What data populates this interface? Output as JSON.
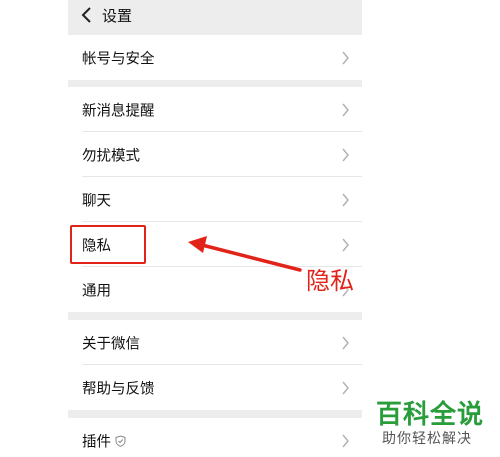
{
  "header": {
    "title": "设置"
  },
  "groups": [
    {
      "items": [
        {
          "label": "帐号与安全"
        }
      ]
    },
    {
      "items": [
        {
          "label": "新消息提醒"
        },
        {
          "label": "勿扰模式"
        },
        {
          "label": "聊天"
        },
        {
          "label": "隐私"
        },
        {
          "label": "通用"
        }
      ]
    },
    {
      "items": [
        {
          "label": "关于微信"
        },
        {
          "label": "帮助与反馈"
        }
      ]
    },
    {
      "items": [
        {
          "label": "插件"
        }
      ]
    }
  ],
  "annotation": {
    "text": "隐私",
    "color": "#e2231a"
  },
  "watermark": {
    "main": "百科全说",
    "sub": "助你轻松解决"
  },
  "icons": {
    "back": "chevron-left-icon",
    "row_arrow": "chevron-right-icon",
    "plugin_badge": "shield-icon"
  }
}
